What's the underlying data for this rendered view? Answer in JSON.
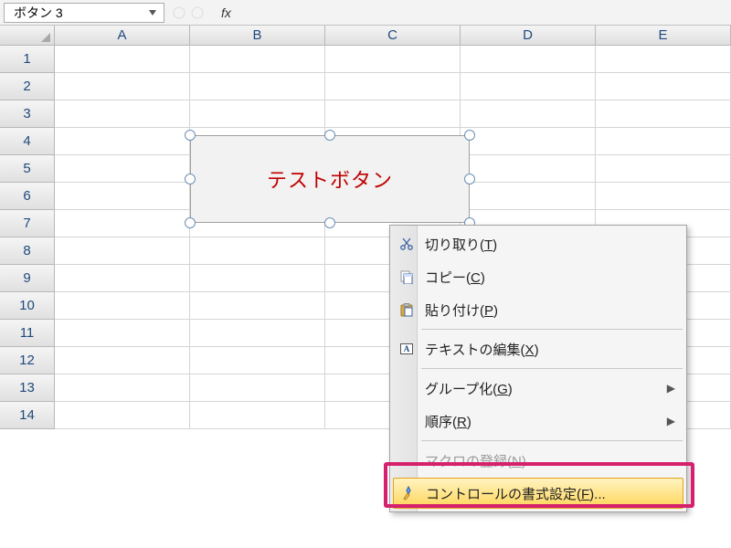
{
  "namebox": {
    "value": "ボタン 3"
  },
  "formula_bar": {
    "fx_label": "fx"
  },
  "columns": [
    "A",
    "B",
    "C",
    "D",
    "E"
  ],
  "rows": [
    1,
    2,
    3,
    4,
    5,
    6,
    7,
    8,
    9,
    10,
    11,
    12,
    13,
    14
  ],
  "button_shape": {
    "label": "テストボタン"
  },
  "context_menu": {
    "items": [
      {
        "id": "cut",
        "label": "切り取り(",
        "mnemonic": "T",
        "suffix": ")",
        "icon": "scissors",
        "enabled": true
      },
      {
        "id": "copy",
        "label": "コピー(",
        "mnemonic": "C",
        "suffix": ")",
        "icon": "copy",
        "enabled": true
      },
      {
        "id": "paste",
        "label": "貼り付け(",
        "mnemonic": "P",
        "suffix": ")",
        "icon": "paste",
        "enabled": true
      },
      {
        "sep": true
      },
      {
        "id": "edittext",
        "label": "テキストの編集(",
        "mnemonic": "X",
        "suffix": ")",
        "icon": "textbox",
        "enabled": true
      },
      {
        "sep": true
      },
      {
        "id": "group",
        "label": "グループ化(",
        "mnemonic": "G",
        "suffix": ")",
        "submenu": true,
        "enabled": true
      },
      {
        "id": "order",
        "label": "順序(",
        "mnemonic": "R",
        "suffix": ")",
        "submenu": true,
        "enabled": true
      },
      {
        "sep": true
      },
      {
        "id": "macro",
        "label": "マクロの登録(",
        "mnemonic": "N",
        "suffix": ")...",
        "enabled": false
      },
      {
        "id": "format",
        "label": "コントロールの書式設定(",
        "mnemonic": "F",
        "suffix": ")...",
        "icon": "format",
        "enabled": true,
        "highlight": true
      }
    ]
  }
}
